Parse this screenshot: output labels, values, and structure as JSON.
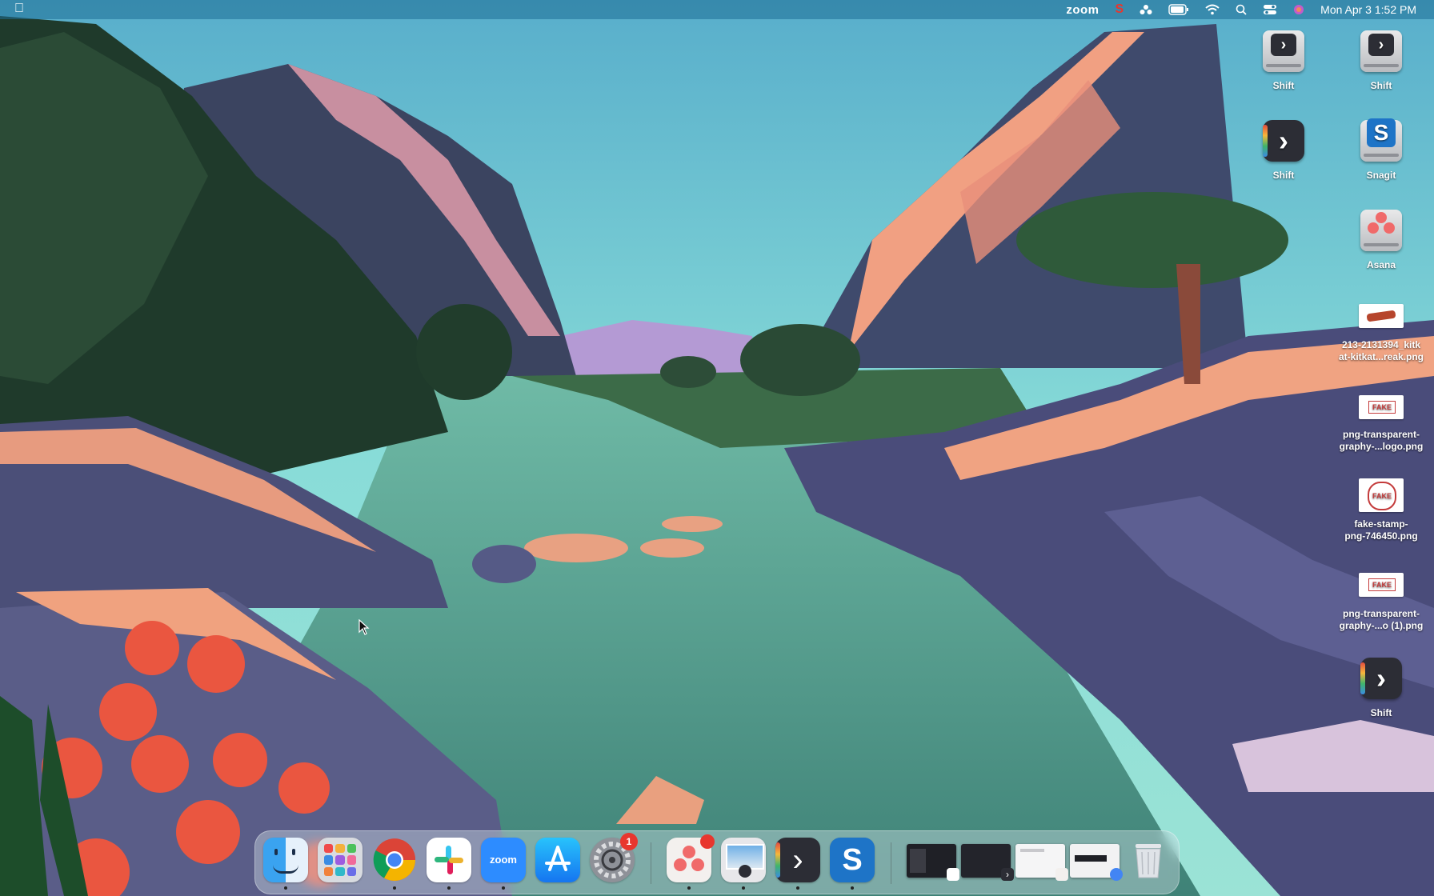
{
  "menubar": {
    "zoom_label": "zoom",
    "datetime": "Mon Apr 3  1:52 PM",
    "icons": [
      "apple-icon",
      "zoom-menu",
      "snagit-icon",
      "asana-icon",
      "battery-icon",
      "wifi-icon",
      "search-icon",
      "control-center-icon",
      "siri-icon"
    ]
  },
  "desktop_icons": [
    {
      "label": "Shift",
      "icon": "shift-drive-icon"
    },
    {
      "label": "Shift",
      "icon": "shift-drive-icon"
    },
    {
      "label": "Shift",
      "icon": "shift-app-icon"
    },
    {
      "label": "Snagit",
      "icon": "snagit-drive-icon"
    },
    {
      "label": "Asana",
      "icon": "asana-drive-icon"
    },
    {
      "label": "213-2131394_kitkat-kitkat...reak.png",
      "line1": "213-2131394_kitk",
      "line2": "at-kitkat...reak.png",
      "icon": "image-file-icon"
    },
    {
      "label": "png-transparent-graphy-...logo.png",
      "line1": "png-transparent-",
      "line2": "graphy-...logo.png",
      "icon": "image-file-icon"
    },
    {
      "label": "fake-stamp-png-746450.png",
      "line1": "fake-stamp-",
      "line2": "png-746450.png",
      "icon": "image-file-icon"
    },
    {
      "label": "png-transparent-graphy-...o (1).png",
      "line1": "png-transparent-",
      "line2": "graphy-...o (1).png",
      "icon": "image-file-icon"
    },
    {
      "label": "Shift",
      "icon": "shift-app-icon"
    }
  ],
  "thumb_text": {
    "fake": "FAKE"
  },
  "dock": {
    "apps": [
      {
        "name": "Finder",
        "icon": "finder-icon",
        "running": true
      },
      {
        "name": "Launchpad",
        "icon": "launchpad-icon",
        "running": false
      },
      {
        "name": "Google Chrome",
        "icon": "chrome-icon",
        "running": true
      },
      {
        "name": "Slack",
        "icon": "slack-icon",
        "running": true
      },
      {
        "name": "Zoom",
        "icon": "zoom-icon",
        "label": "zoom",
        "running": true
      },
      {
        "name": "App Store",
        "icon": "app-store-icon",
        "running": false
      },
      {
        "name": "System Settings",
        "icon": "system-settings-icon",
        "badge": "1",
        "running": false
      },
      {
        "name": "Asana",
        "icon": "asana-icon",
        "badge": "",
        "running": true
      },
      {
        "name": "Preview",
        "icon": "preview-icon",
        "running": true
      },
      {
        "name": "Shift",
        "icon": "shift-icon",
        "running": true
      },
      {
        "name": "Snagit",
        "icon": "snagit-icon",
        "running": true
      }
    ],
    "minimized": [
      "window-thumb-slack",
      "window-thumb-shift",
      "window-thumb-asana",
      "window-thumb-chrome"
    ],
    "trash": "trash-icon"
  },
  "colors": {
    "menubar": "#1e6e96",
    "badge": "#e8362e",
    "dock": "#d2e1e6"
  }
}
